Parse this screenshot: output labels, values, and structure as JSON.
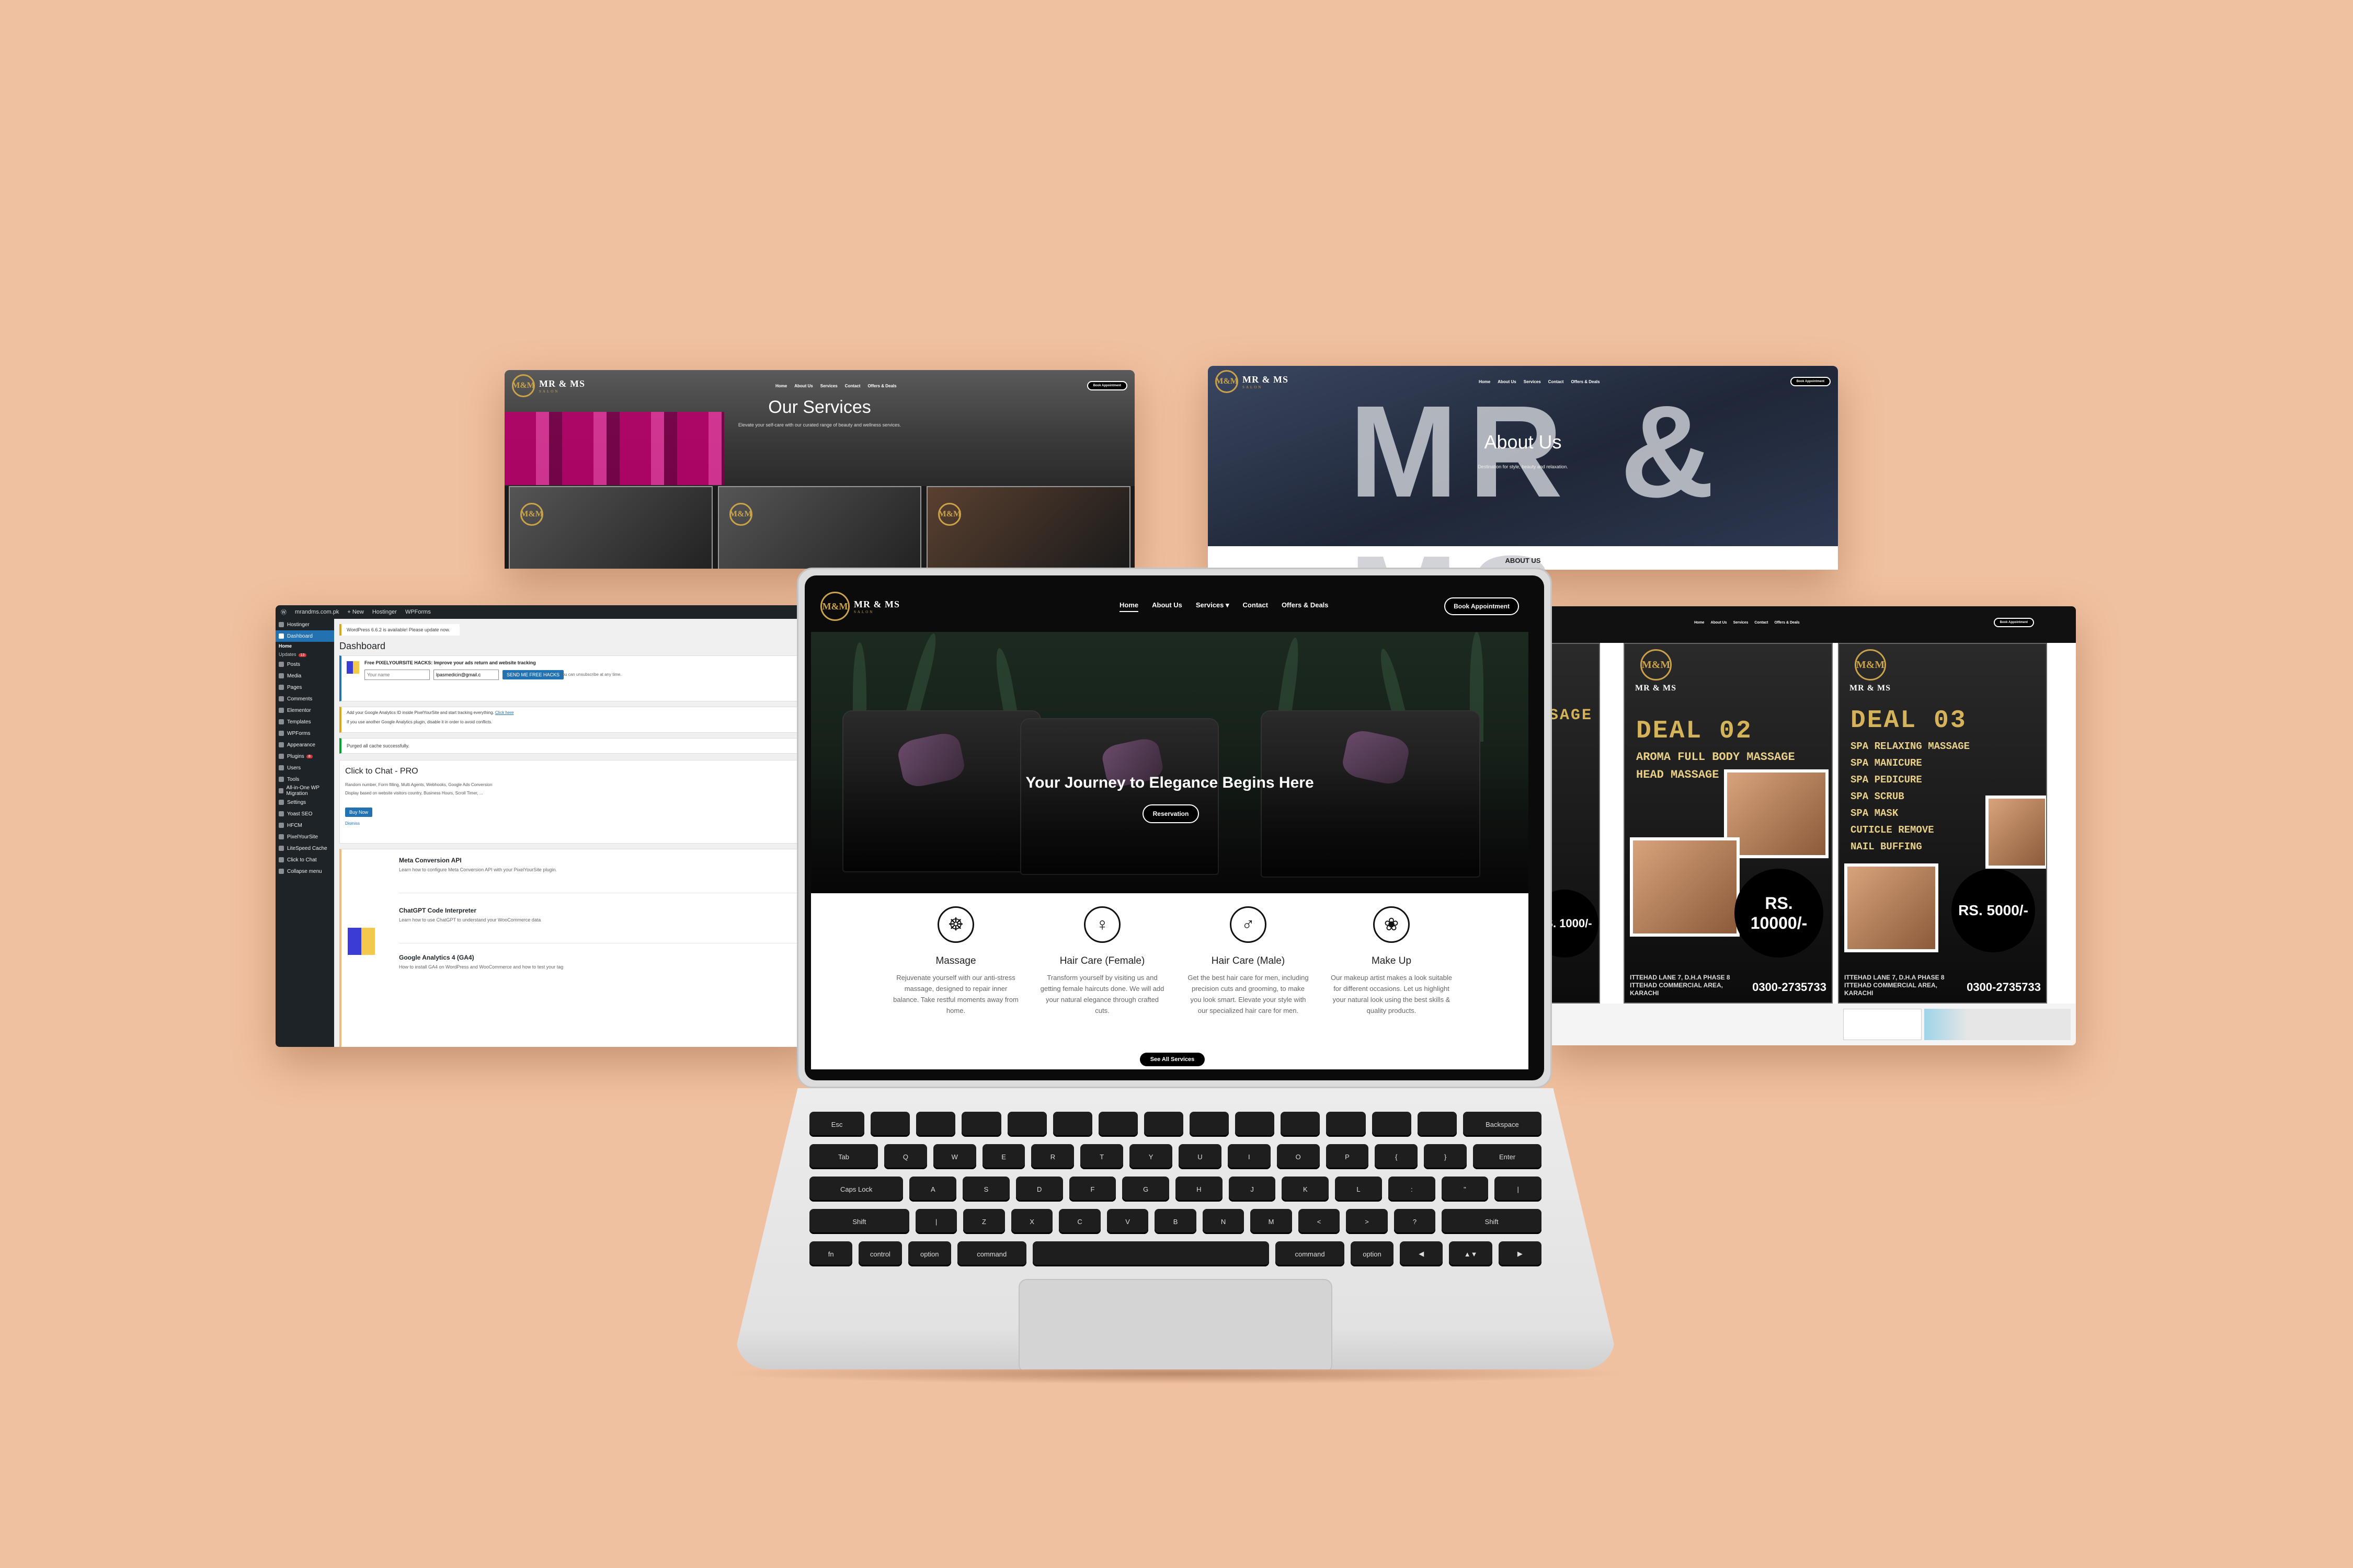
{
  "colors": {
    "background": "#f0c1a0",
    "gold": "#c9a24a",
    "wp_blue": "#2271b1"
  },
  "brand": {
    "logo": "M&M",
    "name": "MR & MS",
    "tagline": "SALON"
  },
  "nav": {
    "links": [
      "Home",
      "About Us",
      "Services",
      "Contact",
      "Offers & Deals"
    ],
    "services_caret": "▾",
    "book_btn": "Book Appointment"
  },
  "services_page": {
    "title": "Our Services",
    "subtitle": "Elevate your self-care with our curated range of beauty and wellness services."
  },
  "about_page": {
    "title": "About Us",
    "subtitle": "Destination for style, beauty and relaxation.",
    "section_heading": "ABOUT US",
    "sign_letters": "MR & MS"
  },
  "deals_page": {
    "deals": [
      {
        "title": "DEAL 02",
        "items": [
          "AROMA FULL BODY MASSAGE",
          "HEAD MASSAGE"
        ],
        "price": "RS. 10000/-",
        "address": "ITTEHAD LANE 7, D.H.A PHASE 8 ITTEHAD COMMERCIAL AREA, KARACHI",
        "phone": "0300-2735733"
      },
      {
        "title": "DEAL 03",
        "items": [
          "SPA RELAXING MASSAGE",
          "SPA MANICURE",
          "SPA PEDICURE",
          "SPA SCRUB",
          "SPA MASK",
          "CUTICLE REMOVE",
          "NAIL BUFFING"
        ],
        "price": "RS. 5000/-",
        "address": "ITTEHAD LANE 7, D.H.A PHASE 8 ITTEHAD COMMERCIAL AREA, KARACHI",
        "phone": "0300-2735733"
      }
    ],
    "partial_price": "RS. 1000/-",
    "partial_title": "SAGE"
  },
  "wp": {
    "site": "mrandms.com.pk",
    "adminbar": [
      "mrandms.com.pk",
      "New",
      "Hostinger",
      "WPForms"
    ],
    "menu": [
      {
        "label": "Hostinger",
        "icon": "hostinger-icon"
      },
      {
        "label": "Dashboard",
        "icon": "dashboard-icon",
        "active": true
      },
      {
        "label": "Posts",
        "icon": "pin-icon"
      },
      {
        "label": "Media",
        "icon": "media-icon"
      },
      {
        "label": "Pages",
        "icon": "pages-icon"
      },
      {
        "label": "Comments",
        "icon": "comments-icon"
      },
      {
        "label": "Elementor",
        "icon": "elementor-icon"
      },
      {
        "label": "Templates",
        "icon": "templates-icon"
      },
      {
        "label": "WPForms",
        "icon": "forms-icon"
      },
      {
        "label": "Appearance",
        "icon": "brush-icon"
      },
      {
        "label": "Plugins",
        "icon": "plugin-icon",
        "badge": "8"
      },
      {
        "label": "Users",
        "icon": "users-icon"
      },
      {
        "label": "Tools",
        "icon": "tools-icon"
      },
      {
        "label": "All-in-One WP Migration",
        "icon": "migration-icon"
      },
      {
        "label": "Settings",
        "icon": "settings-icon"
      },
      {
        "label": "Yoast SEO",
        "icon": "yoast-icon"
      },
      {
        "label": "HFCM",
        "icon": "code-icon"
      },
      {
        "label": "PixelYourSite",
        "icon": "pixel-icon"
      },
      {
        "label": "LiteSpeed Cache",
        "icon": "litespeed-icon"
      },
      {
        "label": "Click to Chat",
        "icon": "chat-icon"
      },
      {
        "label": "Collapse menu",
        "icon": "collapse-icon"
      }
    ],
    "submenu": {
      "home": "Home",
      "updates": "Updates",
      "updates_badge": "13"
    },
    "update_notice": "WordPress 6.6.2 is available! Please update now.",
    "page_title": "Dashboard",
    "pys": {
      "title": "Free PIXELYOURSITE HACKS: Improve your ads return and website tracking",
      "name_ph": "Your name",
      "email_val": "lpasmedicin@gmail.c",
      "btn": "SEND ME FREE HACKS",
      "note": "You can unsubscribe at any time."
    },
    "ga_notice": "Add your Google Analytics ID inside PixelYourSite and start tracking everything.",
    "ga_link": "Click here",
    "ga_notice2": "If you use another Google Analytics plugin, disable it in order to avoid conflicts.",
    "purged": "Purged all cache successfully.",
    "ctc": {
      "title": "Click to Chat - PRO",
      "line1": "Random number, Form filling, Multi Agents, Webhooks, Google Ads Conversion",
      "line2": "Display based on website visitors country, Business Hours, Scroll Timer, ...",
      "btn": "Buy Now",
      "dismiss": "Dismiss"
    },
    "blog": [
      {
        "title": "Meta Conversion API",
        "desc": "Learn how to configure Meta Conversion API with your PixelYourSite plugin."
      },
      {
        "title": "ChatGPT Code Interpreter",
        "desc": "Learn how to use ChatGPT to understand your WooCommerce data"
      },
      {
        "title": "Google Analytics 4 (GA4)",
        "desc": "How to install GA4 on WordPress and WooCommerce and how to test your tag"
      }
    ]
  },
  "home": {
    "hero_title": "Your Journey to Elegance Begins Here",
    "hero_btn": "Reservation",
    "services": [
      {
        "title": "Massage",
        "icon": "massage-icon",
        "glyph": "☸",
        "desc": "Rejuvenate yourself with our anti-stress massage, designed to repair inner balance. Take restful moments away from home."
      },
      {
        "title": "Hair Care (Female)",
        "icon": "female-hair-icon",
        "glyph": "♀",
        "desc": "Transform yourself by visiting us and getting female haircuts done. We will add your natural elegance through crafted cuts."
      },
      {
        "title": "Hair Care (Male)",
        "icon": "male-hair-icon",
        "glyph": "♂",
        "desc": "Get the best hair care for men, including precision cuts and grooming, to make you look smart. Elevate your style with our specialized hair care for men."
      },
      {
        "title": "Make Up",
        "icon": "makeup-icon",
        "glyph": "❀",
        "desc": "Our makeup artist makes a look suitable for different occasions. Let us highlight your natural look using the best skills & quality products."
      }
    ],
    "see_all": "See All Services"
  },
  "keyboard": {
    "row1": [
      "Esc",
      "",
      "",
      "",
      "",
      "",
      "",
      "",
      "",
      "",
      "",
      "",
      "",
      "",
      "Backspace"
    ],
    "row2": [
      "Tab",
      "Q",
      "W",
      "E",
      "R",
      "T",
      "Y",
      "U",
      "I",
      "O",
      "P",
      "{",
      "}",
      "Enter"
    ],
    "row3": [
      "Caps Lock",
      "A",
      "S",
      "D",
      "F",
      "G",
      "H",
      "J",
      "K",
      "L",
      ":",
      "\"",
      "|"
    ],
    "row4": [
      "Shift",
      "|",
      "Z",
      "X",
      "C",
      "V",
      "B",
      "N",
      "M",
      "<",
      ">",
      "?",
      "Shift"
    ],
    "row5": [
      "fn",
      "control",
      "option",
      "command",
      "",
      "command",
      "option",
      "◀",
      "▲▼",
      "▶"
    ]
  }
}
